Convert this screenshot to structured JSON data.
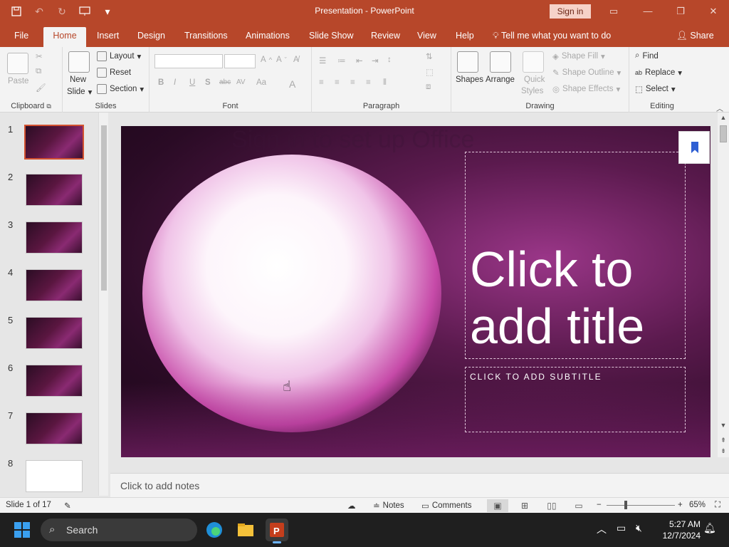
{
  "window": {
    "title": "Presentation - PowerPoint",
    "sign_in": "Sign in"
  },
  "menu": {
    "tabs": [
      "File",
      "Home",
      "Insert",
      "Design",
      "Transitions",
      "Animations",
      "Slide Show",
      "Review",
      "View",
      "Help"
    ],
    "active_tab": "Home",
    "tell_me": "Tell me what you want to do",
    "share": "Share"
  },
  "ribbon": {
    "clipboard": {
      "label": "Clipboard",
      "paste": "Paste"
    },
    "slides": {
      "label": "Slides",
      "new_slide": "New",
      "new_slide_2": "Slide",
      "layout": "Layout",
      "reset": "Reset",
      "section": "Section"
    },
    "font": {
      "label": "Font",
      "bold": "B",
      "italic": "I",
      "underline": "U",
      "shadow": "S",
      "strike": "abc",
      "spacing": "AV",
      "case": "Aa",
      "color": "A"
    },
    "paragraph": {
      "label": "Paragraph"
    },
    "drawing": {
      "label": "Drawing",
      "shapes": "Shapes",
      "arrange": "Arrange",
      "quick_styles": "Quick",
      "quick_styles_2": "Styles",
      "shape_fill": "Shape Fill",
      "shape_outline": "Shape Outline",
      "shape_effects": "Shape Effects"
    },
    "editing": {
      "label": "Editing",
      "find": "Find",
      "replace": "Replace",
      "select": "Select"
    }
  },
  "thumbnails": {
    "numbers": [
      "1",
      "2",
      "3",
      "4",
      "5",
      "6",
      "7",
      "8"
    ],
    "active": 1
  },
  "slide": {
    "ghost_heading": "Sign in to set up Office",
    "title_placeholder_line1": "Click to",
    "title_placeholder_line2": "add title",
    "subtitle_placeholder": "CLICK TO ADD SUBTITLE"
  },
  "notes": {
    "placeholder": "Click to add notes"
  },
  "status": {
    "slide_info": "Slide 1 of 17",
    "notes": "Notes",
    "comments": "Comments",
    "zoom_minus": "−",
    "zoom_plus": "+",
    "zoom_level": "65%"
  },
  "taskbar": {
    "search": "Search",
    "time": "5:27 AM",
    "date": "12/7/2024"
  },
  "colors": {
    "accent": "#b7472a",
    "active_thumb_border": "#d35230",
    "bookmark": "#2e5fd3"
  }
}
